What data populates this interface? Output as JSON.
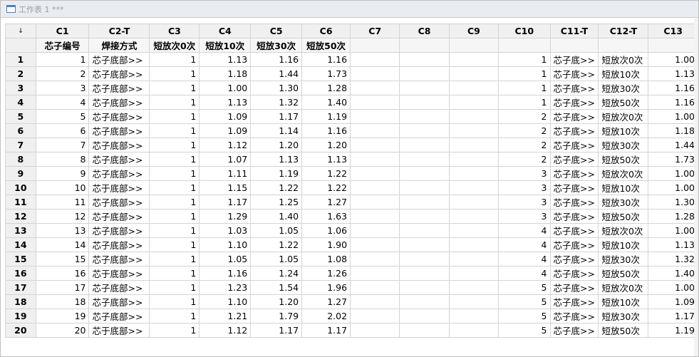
{
  "window": {
    "title": "工作表 1 ***"
  },
  "corner": "↓",
  "columns": [
    {
      "id": "C1",
      "name": "芯子编号",
      "type": "num"
    },
    {
      "id": "C2-T",
      "name": "焊接方式",
      "type": "txt"
    },
    {
      "id": "C3",
      "name": "短放次0次",
      "type": "num"
    },
    {
      "id": "C4",
      "name": "短放10次",
      "type": "num"
    },
    {
      "id": "C5",
      "name": "短放30次",
      "type": "num"
    },
    {
      "id": "C6",
      "name": "短放50次",
      "type": "num"
    },
    {
      "id": "C7",
      "name": "",
      "type": "num"
    },
    {
      "id": "C8",
      "name": "",
      "type": "num"
    },
    {
      "id": "C9",
      "name": "",
      "type": "num"
    },
    {
      "id": "C10",
      "name": "",
      "type": "num"
    },
    {
      "id": "C11-T",
      "name": "",
      "type": "txt"
    },
    {
      "id": "C12-T",
      "name": "",
      "type": "txt"
    },
    {
      "id": "C13",
      "name": "",
      "type": "num"
    }
  ],
  "rows": [
    [
      "1",
      "芯子底部>>",
      "1",
      "1.13",
      "1.16",
      "1.16",
      "",
      "",
      "",
      "1",
      "芯子底>>",
      "短放次0次",
      "1.00"
    ],
    [
      "2",
      "芯子底部>>",
      "1",
      "1.18",
      "1.44",
      "1.73",
      "",
      "",
      "",
      "1",
      "芯子底>>",
      "短放10次",
      "1.13"
    ],
    [
      "3",
      "芯子底部>>",
      "1",
      "1.00",
      "1.30",
      "1.28",
      "",
      "",
      "",
      "1",
      "芯子底>>",
      "短放30次",
      "1.16"
    ],
    [
      "4",
      "芯子底部>>",
      "1",
      "1.13",
      "1.32",
      "1.40",
      "",
      "",
      "",
      "1",
      "芯子底>>",
      "短放50次",
      "1.16"
    ],
    [
      "5",
      "芯子底部>>",
      "1",
      "1.09",
      "1.17",
      "1.19",
      "",
      "",
      "",
      "2",
      "芯子底>>",
      "短放次0次",
      "1.00"
    ],
    [
      "6",
      "芯子底部>>",
      "1",
      "1.09",
      "1.14",
      "1.16",
      "",
      "",
      "",
      "2",
      "芯子底>>",
      "短放10次",
      "1.18"
    ],
    [
      "7",
      "芯子底部>>",
      "1",
      "1.12",
      "1.20",
      "1.20",
      "",
      "",
      "",
      "2",
      "芯子底>>",
      "短放30次",
      "1.44"
    ],
    [
      "8",
      "芯子底部>>",
      "1",
      "1.07",
      "1.13",
      "1.13",
      "",
      "",
      "",
      "2",
      "芯子底>>",
      "短放50次",
      "1.73"
    ],
    [
      "9",
      "芯子底部>>",
      "1",
      "1.11",
      "1.19",
      "1.22",
      "",
      "",
      "",
      "3",
      "芯子底>>",
      "短放次0次",
      "1.00"
    ],
    [
      "10",
      "芯于底部>>",
      "1",
      "1.15",
      "1.22",
      "1.22",
      "",
      "",
      "",
      "3",
      "芯子底>>",
      "短放10次",
      "1.00"
    ],
    [
      "11",
      "芯子底部>>",
      "1",
      "1.17",
      "1.25",
      "1.27",
      "",
      "",
      "",
      "3",
      "芯子底>>",
      "短放30次",
      "1.30"
    ],
    [
      "12",
      "芯子底部>>",
      "1",
      "1.29",
      "1.40",
      "1.63",
      "",
      "",
      "",
      "3",
      "芯子底>>",
      "短放50次",
      "1.28"
    ],
    [
      "13",
      "芯子底部>>",
      "1",
      "1.03",
      "1.05",
      "1.06",
      "",
      "",
      "",
      "4",
      "芯子底>>",
      "短放次0次",
      "1.00"
    ],
    [
      "14",
      "芯子底部>>",
      "1",
      "1.10",
      "1.22",
      "1.90",
      "",
      "",
      "",
      "4",
      "芯子底>>",
      "短放10次",
      "1.13"
    ],
    [
      "15",
      "芯子底部>>",
      "1",
      "1.05",
      "1.05",
      "1.08",
      "",
      "",
      "",
      "4",
      "芯子底>>",
      "短放30次",
      "1.32"
    ],
    [
      "16",
      "芯于底部>>",
      "1",
      "1.16",
      "1.24",
      "1.26",
      "",
      "",
      "",
      "4",
      "芯子底>>",
      "短放50次",
      "1.40"
    ],
    [
      "17",
      "芯子底部>>",
      "1",
      "1.23",
      "1.54",
      "1.96",
      "",
      "",
      "",
      "5",
      "芯子底>>",
      "短放次0次",
      "1.00"
    ],
    [
      "18",
      "芯子底部>>",
      "1",
      "1.10",
      "1.20",
      "1.27",
      "",
      "",
      "",
      "5",
      "芯子底>>",
      "短放10次",
      "1.09"
    ],
    [
      "19",
      "芯子底部>>",
      "1",
      "1.21",
      "1.79",
      "2.02",
      "",
      "",
      "",
      "5",
      "芯子底>>",
      "短放30次",
      "1.17"
    ],
    [
      "20",
      "芯于底部>>",
      "1",
      "1.12",
      "1.17",
      "1.17",
      "",
      "",
      "",
      "5",
      "芯子底>>",
      "短放50次",
      "1.19"
    ]
  ]
}
